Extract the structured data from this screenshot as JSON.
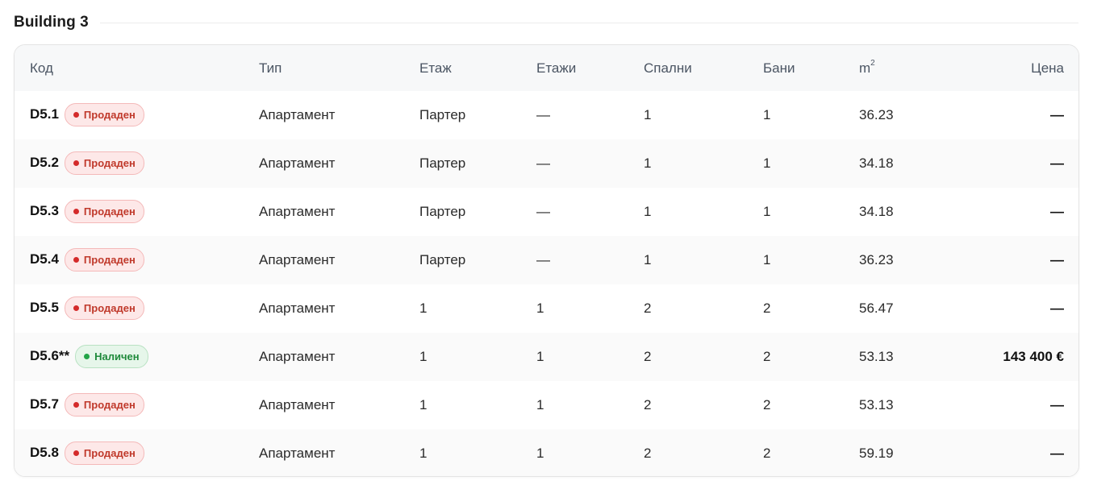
{
  "section": {
    "title": "Building 3"
  },
  "table": {
    "headers": {
      "code": "Код",
      "type": "Тип",
      "floor": "Етаж",
      "floors": "Етажи",
      "bedrooms": "Спални",
      "bathrooms": "Бани",
      "area_base": "m",
      "area_exp": "2",
      "price": "Цена"
    },
    "rows": [
      {
        "code": "D5.1",
        "status": "Продаден",
        "status_kind": "sold",
        "type": "Апартамент",
        "floor": "Партер",
        "floors": "—",
        "bedrooms": "1",
        "bathrooms": "1",
        "area": "36.23",
        "price": "—"
      },
      {
        "code": "D5.2",
        "status": "Продаден",
        "status_kind": "sold",
        "type": "Апартамент",
        "floor": "Партер",
        "floors": "—",
        "bedrooms": "1",
        "bathrooms": "1",
        "area": "34.18",
        "price": "—"
      },
      {
        "code": "D5.3",
        "status": "Продаден",
        "status_kind": "sold",
        "type": "Апартамент",
        "floor": "Партер",
        "floors": "—",
        "bedrooms": "1",
        "bathrooms": "1",
        "area": "34.18",
        "price": "—"
      },
      {
        "code": "D5.4",
        "status": "Продаден",
        "status_kind": "sold",
        "type": "Апартамент",
        "floor": "Партер",
        "floors": "—",
        "bedrooms": "1",
        "bathrooms": "1",
        "area": "36.23",
        "price": "—"
      },
      {
        "code": "D5.5",
        "status": "Продаден",
        "status_kind": "sold",
        "type": "Апартамент",
        "floor": "1",
        "floors": "1",
        "bedrooms": "2",
        "bathrooms": "2",
        "area": "56.47",
        "price": "—"
      },
      {
        "code": "D5.6**",
        "status": "Наличен",
        "status_kind": "available",
        "type": "Апартамент",
        "floor": "1",
        "floors": "1",
        "bedrooms": "2",
        "bathrooms": "2",
        "area": "53.13",
        "price": "143 400 €"
      },
      {
        "code": "D5.7",
        "status": "Продаден",
        "status_kind": "sold",
        "type": "Апартамент",
        "floor": "1",
        "floors": "1",
        "bedrooms": "2",
        "bathrooms": "2",
        "area": "53.13",
        "price": "—"
      },
      {
        "code": "D5.8",
        "status": "Продаден",
        "status_kind": "sold",
        "type": "Апартамент",
        "floor": "1",
        "floors": "1",
        "bedrooms": "2",
        "bathrooms": "2",
        "area": "59.19",
        "price": "—"
      }
    ]
  },
  "colors": {
    "sold_badge_bg": "#fde8e8",
    "sold_badge_text": "#c0392b",
    "available_badge_bg": "#e6f6ea",
    "available_badge_text": "#1f8a3b",
    "header_bg": "#f7f8f9"
  }
}
